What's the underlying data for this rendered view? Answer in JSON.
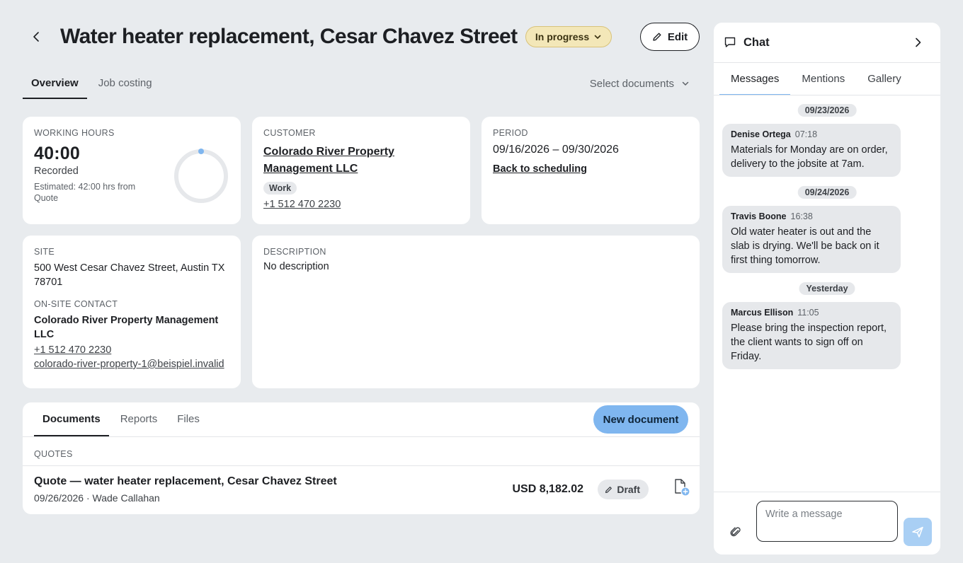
{
  "header": {
    "title": "Water heater replacement, Cesar Chavez Street",
    "status": "In progress",
    "edit_label": "Edit"
  },
  "tabs": {
    "overview": "Overview",
    "job_costing": "Job costing",
    "select_documents": "Select documents"
  },
  "working_hours": {
    "label": "WORKING HOURS",
    "value": "40:00",
    "recorded": "Recorded",
    "estimate": "Estimated: 42:00 hrs from Quote"
  },
  "customer": {
    "label": "CUSTOMER",
    "name": "Colorado River Property Management LLC",
    "tag": "Work",
    "phone": "+1 512 470 2230"
  },
  "period": {
    "label": "PERIOD",
    "range": "09/16/2026 – 09/30/2026",
    "back_link": "Back to scheduling"
  },
  "site": {
    "label": "SITE",
    "address": "500 West Cesar Chavez Street, Austin TX 78701",
    "contact_label": "ON-SITE CONTACT",
    "contact_name": "Colorado River Property Management LLC",
    "contact_phone": "+1 512 470 2230",
    "contact_email": "colorado-river-property-1@beispiel.invalid"
  },
  "description": {
    "label": "DESCRIPTION",
    "text": "No description"
  },
  "documents": {
    "tabs": [
      "Documents",
      "Reports",
      "Files"
    ],
    "new_button": "New document",
    "section_label": "QUOTES",
    "quote": {
      "title": "Quote — water heater replacement, Cesar Chavez Street",
      "meta": "09/26/2026 · Wade Callahan",
      "amount": "USD 8,182.02",
      "status": "Draft"
    }
  },
  "chat": {
    "title": "Chat",
    "tabs": [
      "Messages",
      "Mentions",
      "Gallery"
    ],
    "groups": [
      {
        "date": "09/23/2026",
        "author": "Denise Ortega",
        "time": "07:18",
        "text": "Materials for Monday are on order, delivery to the jobsite at 7am."
      },
      {
        "date": "09/24/2026",
        "author": "Travis Boone",
        "time": "16:38",
        "text": "Old water heater is out and the slab is drying. We'll be back on it first thing tomorrow."
      },
      {
        "date": "Yesterday",
        "author": "Marcus Ellison",
        "time": "11:05",
        "text": "Please bring the inspection report, the client wants to sign off on Friday."
      }
    ],
    "input_placeholder": "Write a message"
  },
  "colors": {
    "accent": "#7fb6ef",
    "status_badge_bg": "#f3e7b8",
    "background": "#e8ebee"
  },
  "hours_progress": 0
}
